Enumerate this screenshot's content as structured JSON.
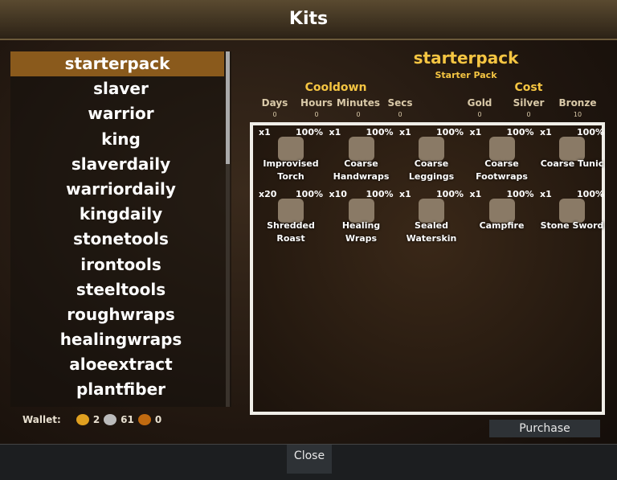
{
  "title": "Kits",
  "kits": [
    "starterpack",
    "slaver",
    "warrior",
    "king",
    "slaverdaily",
    "warriordaily",
    "kingdaily",
    "stonetools",
    "irontools",
    "steeltools",
    "roughwraps",
    "healingwraps",
    "aloeextract",
    "plantfiber"
  ],
  "selected": {
    "name": "starterpack",
    "subtitle": "Starter Pack"
  },
  "cooldown": {
    "label": "Cooldown",
    "cols": [
      {
        "label": "Days",
        "value": "0"
      },
      {
        "label": "Hours",
        "value": "0"
      },
      {
        "label": "Minutes",
        "value": "0"
      },
      {
        "label": "Secs",
        "value": "0"
      }
    ]
  },
  "cost": {
    "label": "Cost",
    "cols": [
      {
        "label": "Gold",
        "value": "0"
      },
      {
        "label": "Silver",
        "value": "0"
      },
      {
        "label": "Bronze",
        "value": "10"
      }
    ]
  },
  "items": [
    {
      "qty": "x1",
      "pct": "100%",
      "name": "Improvised Torch",
      "icon": "torch-icon"
    },
    {
      "qty": "x1",
      "pct": "100%",
      "name": "Coarse Handwraps",
      "icon": "handwraps-icon"
    },
    {
      "qty": "x1",
      "pct": "100%",
      "name": "Coarse Leggings",
      "icon": "leggings-icon"
    },
    {
      "qty": "x1",
      "pct": "100%",
      "name": "Coarse Footwraps",
      "icon": "footwraps-icon"
    },
    {
      "qty": "x1",
      "pct": "100%",
      "name": "Coarse Tunic",
      "icon": "tunic-icon"
    },
    {
      "qty": "x20",
      "pct": "100%",
      "name": "Shredded Roast",
      "icon": "roast-icon"
    },
    {
      "qty": "x10",
      "pct": "100%",
      "name": "Healing Wraps",
      "icon": "healing-wraps-icon"
    },
    {
      "qty": "x1",
      "pct": "100%",
      "name": "Sealed Waterskin",
      "icon": "waterskin-icon"
    },
    {
      "qty": "x1",
      "pct": "100%",
      "name": "Campfire",
      "icon": "campfire-icon"
    },
    {
      "qty": "x1",
      "pct": "100%",
      "name": "Stone Sword",
      "icon": "sword-icon"
    }
  ],
  "wallet": {
    "label": "Wallet:",
    "gold": "2",
    "silver": "61",
    "bronze": "0"
  },
  "purchase_label": "Purchase",
  "close_label": "Close"
}
